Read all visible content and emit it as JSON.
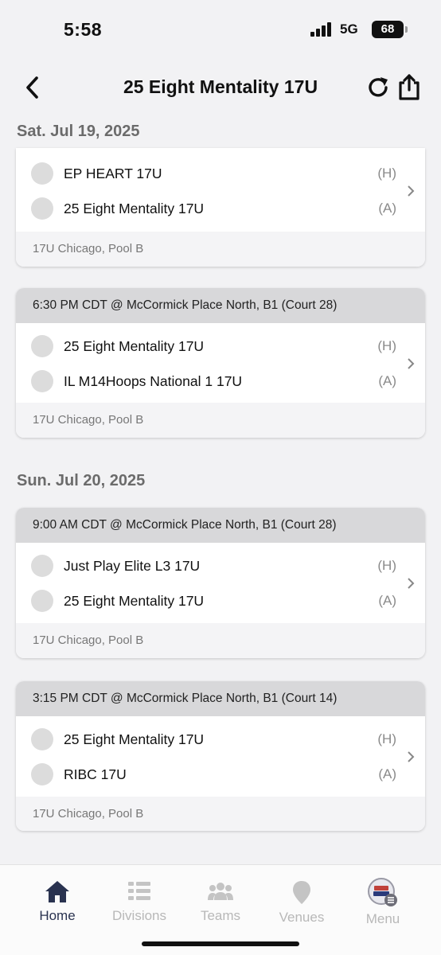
{
  "status": {
    "time": "5:58",
    "network": "5G",
    "battery": "68"
  },
  "nav": {
    "title": "25 Eight Mentality 17U"
  },
  "days": [
    {
      "date": "Sat. Jul 19, 2025",
      "games": [
        {
          "header": "",
          "home": "EP HEART 17U",
          "home_tag": "(H)",
          "away": "25 Eight Mentality 17U",
          "away_tag": "(A)",
          "pool": "17U Chicago, Pool B"
        },
        {
          "header": "6:30 PM CDT @ McCormick Place North, B1 (Court 28)",
          "home": "25 Eight Mentality 17U",
          "home_tag": "(H)",
          "away": "IL M14Hoops National 1 17U",
          "away_tag": "(A)",
          "pool": "17U Chicago, Pool B"
        }
      ]
    },
    {
      "date": "Sun. Jul 20, 2025",
      "games": [
        {
          "header": "9:00 AM CDT @ McCormick Place North, B1 (Court 28)",
          "home": "Just Play Elite L3 17U",
          "home_tag": "(H)",
          "away": "25 Eight Mentality 17U",
          "away_tag": "(A)",
          "pool": "17U Chicago, Pool B"
        },
        {
          "header": "3:15 PM CDT @ McCormick Place North, B1 (Court 14)",
          "home": "25 Eight Mentality 17U",
          "home_tag": "(H)",
          "away": "RIBC 17U",
          "away_tag": "(A)",
          "pool": "17U Chicago, Pool B"
        }
      ]
    }
  ],
  "tabs": [
    {
      "label": "Home",
      "icon": "home-icon",
      "active": true
    },
    {
      "label": "Divisions",
      "icon": "divisions-icon",
      "active": false
    },
    {
      "label": "Teams",
      "icon": "teams-icon",
      "active": false
    },
    {
      "label": "Venues",
      "icon": "venues-icon",
      "active": false
    },
    {
      "label": "Menu",
      "icon": "menu-logo-icon",
      "active": false
    }
  ],
  "colors": {
    "accent": "#2a3350",
    "inactive": "#b8b8b8",
    "card_header": "#d8d8da",
    "background": "#f2f2f4"
  }
}
